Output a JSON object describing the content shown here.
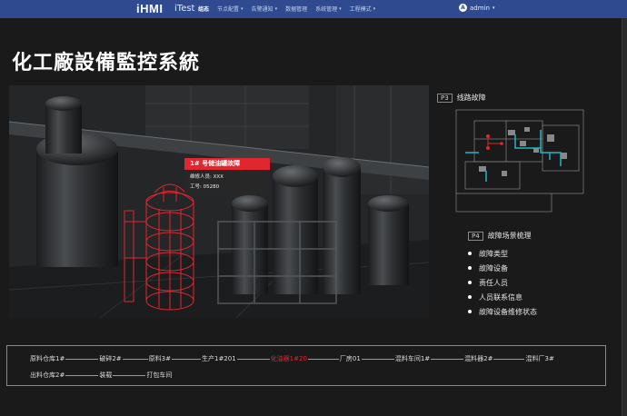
{
  "navbar": {
    "brand": "iHMI",
    "app_name": "iTest",
    "items": [
      {
        "label": "组态",
        "active": true,
        "dropdown": false
      },
      {
        "label": "节点配置",
        "active": false,
        "dropdown": true
      },
      {
        "label": "告警通知",
        "active": false,
        "dropdown": true
      },
      {
        "label": "数据管理",
        "active": false,
        "dropdown": false
      },
      {
        "label": "系统管理",
        "active": false,
        "dropdown": true
      },
      {
        "label": "工程模式",
        "active": false,
        "dropdown": true
      }
    ],
    "user": "admin",
    "user_initial": "A"
  },
  "page": {
    "title": "化工廠設備監控系統"
  },
  "alert": {
    "title": "1# 号储油罐故障",
    "operator": "维修人员: XXX",
    "work_no": "工号: 05280"
  },
  "panel_p3": {
    "tag": "P3",
    "title": "线路故障"
  },
  "panel_p4": {
    "tag": "P4",
    "title": "故障场景梳理",
    "items": [
      "故障类型",
      "故障设备",
      "责任人员",
      "人员联系信息",
      "故障设备维修状态"
    ]
  },
  "process": {
    "row1": [
      {
        "label": "原料仓库1#",
        "alarm": false
      },
      {
        "label": "破碎2#",
        "alarm": false
      },
      {
        "label": "原料3#",
        "alarm": false
      },
      {
        "label": "生产1#201",
        "alarm": false
      },
      {
        "label": "化油器1#20",
        "alarm": true
      },
      {
        "label": "厂房01",
        "alarm": false
      },
      {
        "label": "混料车间1#",
        "alarm": false
      },
      {
        "label": "混料器2#",
        "alarm": false
      },
      {
        "label": "混料厂3#",
        "alarm": false
      }
    ],
    "row2": [
      {
        "label": "出料仓库2#",
        "alarm": false
      },
      {
        "label": "装载",
        "alarm": false
      },
      {
        "label": "打包车间",
        "alarm": false
      }
    ]
  },
  "colors": {
    "navbar": "#2f4a8e",
    "alarm": "#e0262f",
    "pipe": "#27b3c4"
  }
}
